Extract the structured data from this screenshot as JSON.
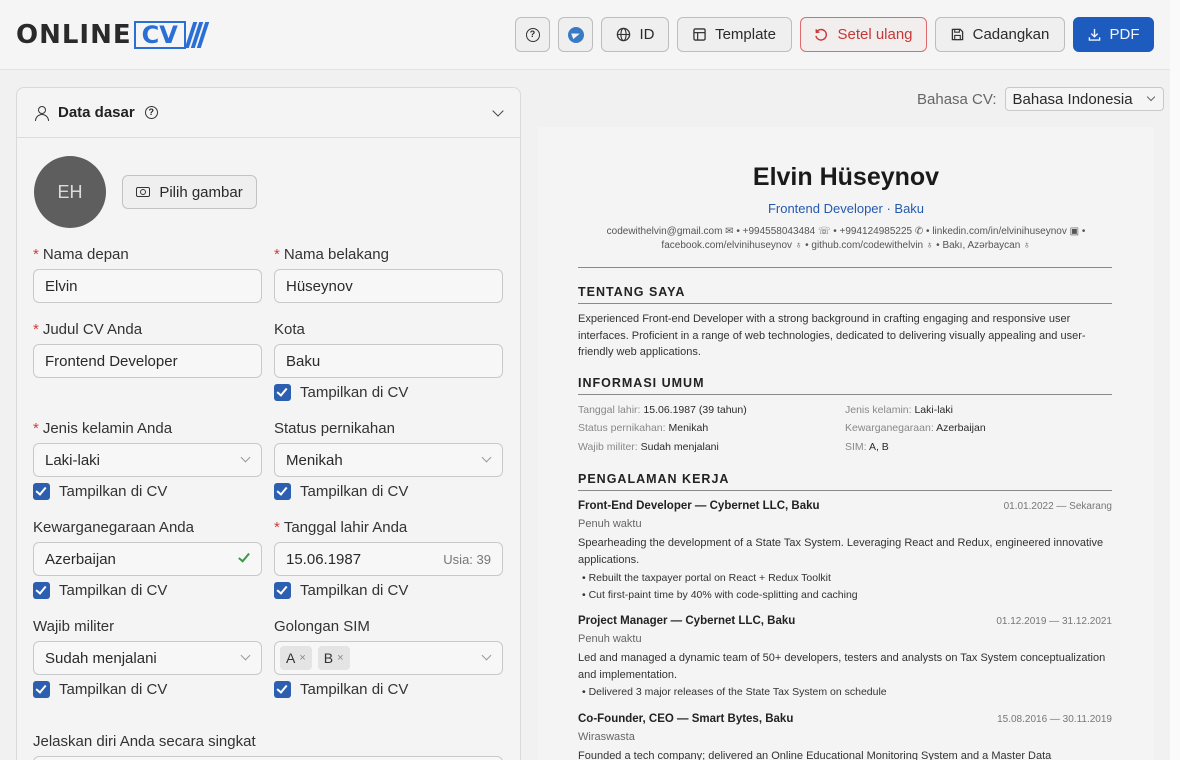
{
  "header": {
    "logo_text": "ONLINE",
    "logo_box": "CV",
    "lang_button": "ID",
    "template_button": "Template",
    "reset_button": "Setel ulang",
    "backup_button": "Cadangkan",
    "pdf_button": "PDF",
    "help_icon": "?"
  },
  "panel": {
    "title": "Data dasar",
    "help_icon": "?",
    "avatar_initials": "EH",
    "pick_image": "Pilih gambar",
    "show_in_cv": "Tampilkan di CV",
    "required_mark": "*",
    "fields": {
      "first_name": {
        "label": "Nama depan",
        "value": "Elvin"
      },
      "last_name": {
        "label": "Nama belakang",
        "value": "Hüseynov"
      },
      "cv_title": {
        "label": "Judul CV Anda",
        "value": "Frontend Developer"
      },
      "city": {
        "label": "Kota",
        "value": "Baku"
      },
      "gender": {
        "label": "Jenis kelamin Anda",
        "value": "Laki-laki"
      },
      "marital": {
        "label": "Status pernikahan",
        "value": "Menikah"
      },
      "citizenship": {
        "label": "Kewarganegaraan Anda",
        "value": "Azerbaijan"
      },
      "birth_date": {
        "label": "Tanggal lahir Anda",
        "value": "15.06.1987",
        "age": "Usia: 39"
      },
      "military": {
        "label": "Wajib militer",
        "value": "Sudah menjalani"
      },
      "license": {
        "label": "Golongan SIM",
        "tags": [
          "A",
          "B"
        ],
        "remove": "×"
      },
      "about": {
        "label": "Jelaskan diri Anda secara singkat"
      }
    }
  },
  "cv_language": {
    "label": "Bahasa CV:",
    "value": "Bahasa Indonesia"
  },
  "cv": {
    "name": "Elvin Hüseynov",
    "title": "Frontend Developer · Baku",
    "contact_line1": "codewithelvin@gmail.com ✉ • +994558043484 ☏ • +994124985225 ✆ • linkedin.com/in/elvinihuseynov ▣ •",
    "contact_line2": "facebook.com/elvinihuseynov ♁ • github.com/codewithelvin ♁ • Bakı, Azərbaycan ♁",
    "about_heading": "TENTANG SAYA",
    "about_text": "Experienced Front-end Developer with a strong background in crafting engaging and responsive user interfaces. Proficient in a range of web technologies, dedicated to delivering visually appealing and user-friendly web applications.",
    "info_heading": "INFORMASI UMUM",
    "info": [
      {
        "k": "Tanggal lahir:",
        "v": "15.06.1987 (39 tahun)"
      },
      {
        "k": "Jenis kelamin:",
        "v": "Laki-laki"
      },
      {
        "k": "Status pernikahan:",
        "v": "Menikah"
      },
      {
        "k": "Kewarganegaraan:",
        "v": "Azerbaijan"
      },
      {
        "k": "Wajib militer:",
        "v": "Sudah menjalani"
      },
      {
        "k": "SIM:",
        "v": "A, B"
      }
    ],
    "work_heading": "PENGALAMAN KERJA",
    "jobs": [
      {
        "title": "Front-End Developer — Cybernet LLC, Baku",
        "dates": "01.01.2022 — Sekarang",
        "type": "Penuh waktu",
        "desc": "Spearheading the development of a State Tax System. Leveraging React and Redux, engineered innovative applications.",
        "bullets": [
          "Rebuilt the taxpayer portal on React + Redux Toolkit",
          "Cut first-paint time by 40% with code-splitting and caching"
        ]
      },
      {
        "title": "Project Manager — Cybernet LLC, Baku",
        "dates": "01.12.2019 — 31.12.2021",
        "type": "Penuh waktu",
        "desc": "Led and managed a dynamic team of 50+ developers, testers and analysts on Tax System conceptualization and implementation.",
        "bullets": [
          "Delivered 3 major releases of the State Tax System on schedule"
        ]
      },
      {
        "title": "Co-Founder, CEO — Smart Bytes, Baku",
        "dates": "15.08.2016 — 30.11.2019",
        "type": "Wiraswasta",
        "desc": "Founded a tech company; delivered an Online Educational Monitoring System and a Master Data"
      }
    ]
  }
}
